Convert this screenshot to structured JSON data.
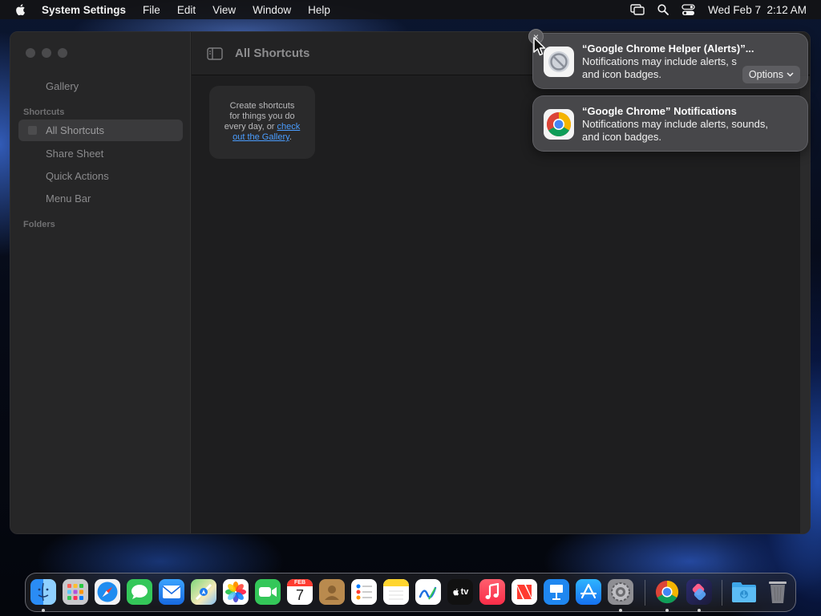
{
  "menubar": {
    "app_name": "System Settings",
    "items": [
      "File",
      "Edit",
      "View",
      "Window",
      "Help"
    ],
    "datetime": "Wed Feb 7  2:12 AM",
    "icons": [
      "screen-mirror-icon",
      "spotlight-search-icon",
      "control-center-icon"
    ]
  },
  "window": {
    "title": "All Shortcuts",
    "sidebar": {
      "gallery": "Gallery",
      "shortcuts_header": "Shortcuts",
      "items": [
        "All Shortcuts",
        "Share Sheet",
        "Quick Actions",
        "Menu Bar"
      ],
      "folders_header": "Folders"
    },
    "empty_state": {
      "line1": "Create shortcuts",
      "line2": "for things you do",
      "line3": "every day, or ",
      "link_a": "check",
      "link_b": "out the Gallery",
      "period": "."
    }
  },
  "notifications": [
    {
      "title": "“Google Chrome Helper (Alerts)”...",
      "body_line1": "Notifications may include alerts, s",
      "body_line2": "and icon badges.",
      "options_label": "Options",
      "icon": "chrome-helper-icon"
    },
    {
      "title": "“Google Chrome” Notifications",
      "body_line1": "Notifications may include alerts, sounds,",
      "body_line2": "and icon badges.",
      "icon": "chrome-icon"
    }
  ],
  "close_glyph": "×",
  "dock": {
    "calendar_month": "FEB",
    "calendar_day": "7",
    "tv_label": "tv",
    "apps": [
      "Finder",
      "Launchpad",
      "Safari",
      "Messages",
      "Mail",
      "Maps",
      "Photos",
      "FaceTime",
      "Calendar",
      "Contacts",
      "Reminders",
      "Notes",
      "Freeform",
      "TV",
      "Music",
      "News",
      "Keynote",
      "App Store",
      "System Settings",
      "Google Chrome",
      "Shortcuts",
      "Downloads",
      "Trash"
    ]
  },
  "colors": {
    "link": "#4a9dff",
    "notification_bg": "#4b4b4e",
    "window_bg": "#1e1e1f",
    "sidebar_bg": "#262627"
  }
}
